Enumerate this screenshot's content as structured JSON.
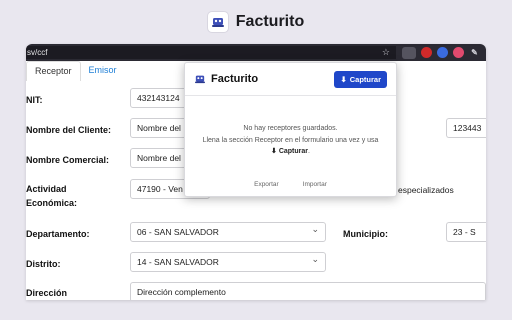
{
  "promo": {
    "title": "Facturito"
  },
  "browser": {
    "url_fragment": "sv/ccf",
    "star": "☆",
    "extensions": [
      {
        "name": "facturito-extension-icon",
        "color": "#55545f"
      },
      {
        "name": "red-extension-icon",
        "color": "#d12a2a"
      },
      {
        "name": "blue-extension-icon",
        "color": "#3a6be0"
      },
      {
        "name": "pink-extension-icon",
        "color": "#e14a6e"
      },
      {
        "name": "eyedropper-icon",
        "color": "#cfcfd6"
      }
    ]
  },
  "form": {
    "tabs": [
      {
        "label": "Receptor"
      },
      {
        "label": "Emisor"
      }
    ],
    "nit": {
      "label": "NIT:",
      "value": "432143124"
    },
    "nombre_cliente": {
      "label": "Nombre del Cliente:",
      "value": "Nombre del",
      "value_right": "123443"
    },
    "nombre_comercial": {
      "label": "Nombre Comercial:",
      "value": "Nombre del"
    },
    "actividad": {
      "label_line1": "Actividad",
      "label_line2": "Económica:",
      "value": "47190 - Ven",
      "value_tail": "especializados"
    },
    "departamento": {
      "label": "Departamento:",
      "value": "06 - SAN SALVADOR"
    },
    "municipio": {
      "label": "Municipio:",
      "value": "23 - S"
    },
    "distrito": {
      "label": "Distrito:",
      "value": "14 - SAN SALVADOR"
    },
    "direccion": {
      "label": "Dirección",
      "value": "Dirección complemento"
    }
  },
  "popup": {
    "title": "Facturito",
    "capture_button": "Capturar",
    "message_line1": "No hay receptores guardados.",
    "message_line2": "Llena la sección Receptor en el formulario una vez y usa",
    "message_line3": "Capturar",
    "export_label": "Exportar",
    "import_label": "Importar",
    "accent_color": "#1f47c9"
  }
}
